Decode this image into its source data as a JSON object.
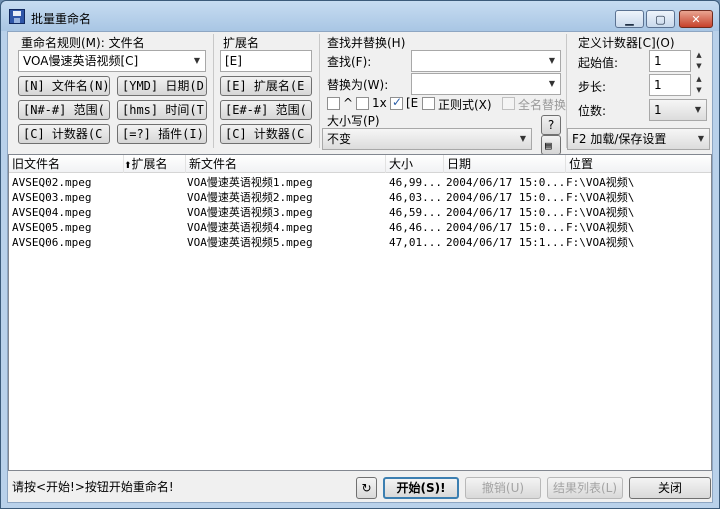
{
  "window": {
    "title": "批量重命名"
  },
  "rename": {
    "rule_label": "重命名规则(M): 文件名",
    "rule_value": "VOA慢速英语视频[C]",
    "buttons": [
      "[N] 文件名(N)",
      "[YMD] 日期(D)",
      "[N#-#] 范围(",
      "[hms] 时间(T",
      "[C] 计数器(C",
      "[=?] 插件(I)"
    ]
  },
  "extension": {
    "label": "扩展名",
    "value": "[E]",
    "buttons": [
      "[E] 扩展名(E",
      "[E#-#] 范围(",
      "[C] 计数器(C"
    ]
  },
  "find_replace": {
    "section_label": "查找并替换(H)",
    "find_label": "查找(F):",
    "replace_label": "替换为(W):",
    "opt_case": "^",
    "opt_once": "1x",
    "opt_ext": "[E",
    "opt_regex": "正则式(X)",
    "opt_all": "全名替换",
    "case_label": "大小写(P)",
    "case_value": "不变",
    "help": "?"
  },
  "counter": {
    "section_label": "定义计数器[C](O)",
    "start_label": "起始值:",
    "start_value": "1",
    "step_label": "步长:",
    "step_value": "1",
    "digits_label": "位数:",
    "digits_value": "1",
    "load_save": "F2 加载/保存设置"
  },
  "list": {
    "columns": [
      "旧文件名",
      "扩展名",
      "新文件名",
      "大小",
      "日期",
      "位置"
    ],
    "rows": [
      [
        "AVSEQ02.mpeg",
        "",
        "VOA慢速英语视频1.mpeg",
        "46,99...",
        "2004/06/17 15:0...",
        "F:\\VOA视频\\"
      ],
      [
        "AVSEQ03.mpeg",
        "",
        "VOA慢速英语视频2.mpeg",
        "46,03...",
        "2004/06/17 15:0...",
        "F:\\VOA视频\\"
      ],
      [
        "AVSEQ04.mpeg",
        "",
        "VOA慢速英语视频3.mpeg",
        "46,59...",
        "2004/06/17 15:0...",
        "F:\\VOA视频\\"
      ],
      [
        "AVSEQ05.mpeg",
        "",
        "VOA慢速英语视频4.mpeg",
        "46,46...",
        "2004/06/17 15:0...",
        "F:\\VOA视频\\"
      ],
      [
        "AVSEQ06.mpeg",
        "",
        "VOA慢速英语视频5.mpeg",
        "47,01...",
        "2004/06/17 15:1...",
        "F:\\VOA视频\\"
      ]
    ]
  },
  "footer": {
    "status": "请按<开始!>按钮开始重命名!",
    "start": "开始(S)!",
    "undo": "撤销(U)",
    "results": "结果列表(L)",
    "close": "关闭"
  }
}
